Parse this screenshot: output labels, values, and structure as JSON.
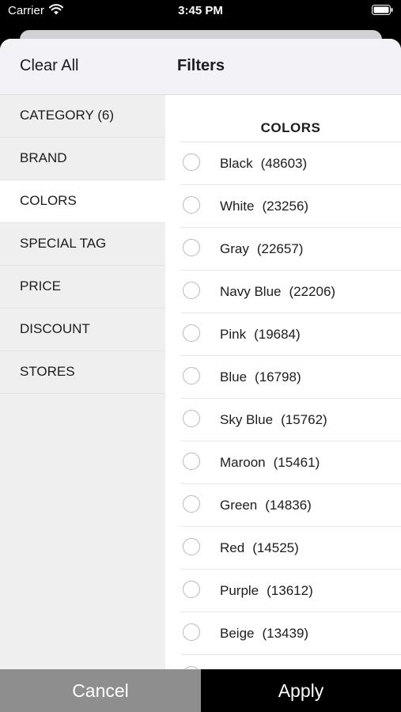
{
  "status_bar": {
    "carrier": "Carrier",
    "time": "3:45 PM",
    "icons": [
      "wifi-icon",
      "battery-icon"
    ]
  },
  "header": {
    "clear_all": "Clear All",
    "title": "Filters"
  },
  "sidebar": {
    "items": [
      {
        "label": "CATEGORY (6)",
        "active": false
      },
      {
        "label": "BRAND",
        "active": false
      },
      {
        "label": "COLORS",
        "active": true
      },
      {
        "label": "SPECIAL TAG",
        "active": false
      },
      {
        "label": "PRICE",
        "active": false
      },
      {
        "label": "DISCOUNT",
        "active": false
      },
      {
        "label": "STORES",
        "active": false
      }
    ]
  },
  "colors": {
    "title": "COLORS",
    "options": [
      {
        "name": "Black",
        "count": "(48603)"
      },
      {
        "name": "White",
        "count": "(23256)"
      },
      {
        "name": "Gray",
        "count": "(22657)"
      },
      {
        "name": "Navy Blue",
        "count": "(22206)"
      },
      {
        "name": "Pink",
        "count": "(19684)"
      },
      {
        "name": "Blue",
        "count": "(16798)"
      },
      {
        "name": "Sky Blue",
        "count": "(15762)"
      },
      {
        "name": "Maroon",
        "count": "(15461)"
      },
      {
        "name": "Green",
        "count": "(14836)"
      },
      {
        "name": "Red",
        "count": "(14525)"
      },
      {
        "name": "Purple",
        "count": "(13612)"
      },
      {
        "name": "Beige",
        "count": "(13439)"
      }
    ]
  },
  "footer": {
    "cancel": "Cancel",
    "apply": "Apply"
  },
  "theme": {
    "sidebar_bg": "#efefef",
    "cancel_bg": "#8e8e8e",
    "apply_bg": "#000000"
  }
}
